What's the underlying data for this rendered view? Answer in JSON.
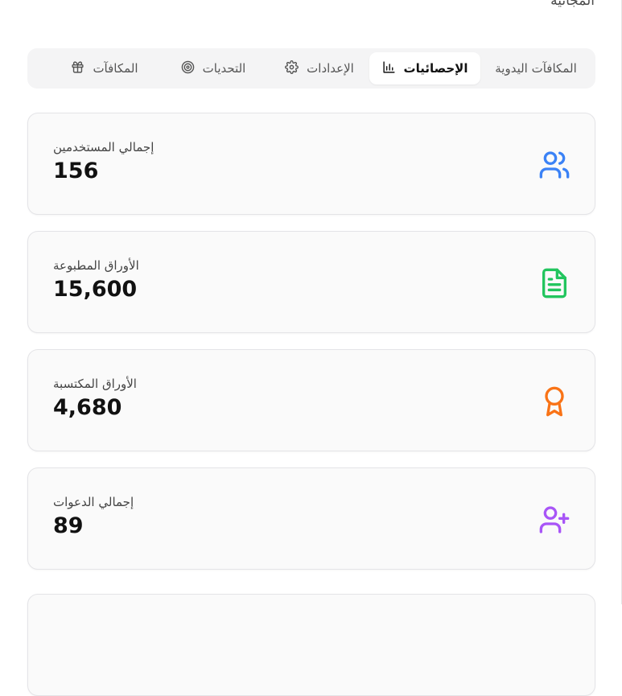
{
  "page": {
    "heading": "المجانية"
  },
  "tabs": [
    {
      "id": "manual",
      "label": "المكافآت اليدوية",
      "icon": ""
    },
    {
      "id": "stats",
      "label": "الإحصائيات",
      "icon": "bar-chart-icon",
      "active": true
    },
    {
      "id": "settings",
      "label": "الإعدادات",
      "icon": "gear-icon"
    },
    {
      "id": "challenges",
      "label": "التحديات",
      "icon": "target-icon"
    },
    {
      "id": "rewards",
      "label": "المكافآت",
      "icon": "gift-icon"
    }
  ],
  "stats": [
    {
      "label": "إجمالي المستخدمين",
      "value": "156",
      "icon": "users-icon",
      "color": "#3b82f6"
    },
    {
      "label": "الأوراق المطبوعة",
      "value": "15,600",
      "icon": "file-text-icon",
      "color": "#22c55e"
    },
    {
      "label": "الأوراق المكتسبة",
      "value": "4,680",
      "icon": "award-icon",
      "color": "#f97316"
    },
    {
      "label": "إجمالي الدعوات",
      "value": "89",
      "icon": "user-plus-icon",
      "color": "#a855f7"
    }
  ]
}
